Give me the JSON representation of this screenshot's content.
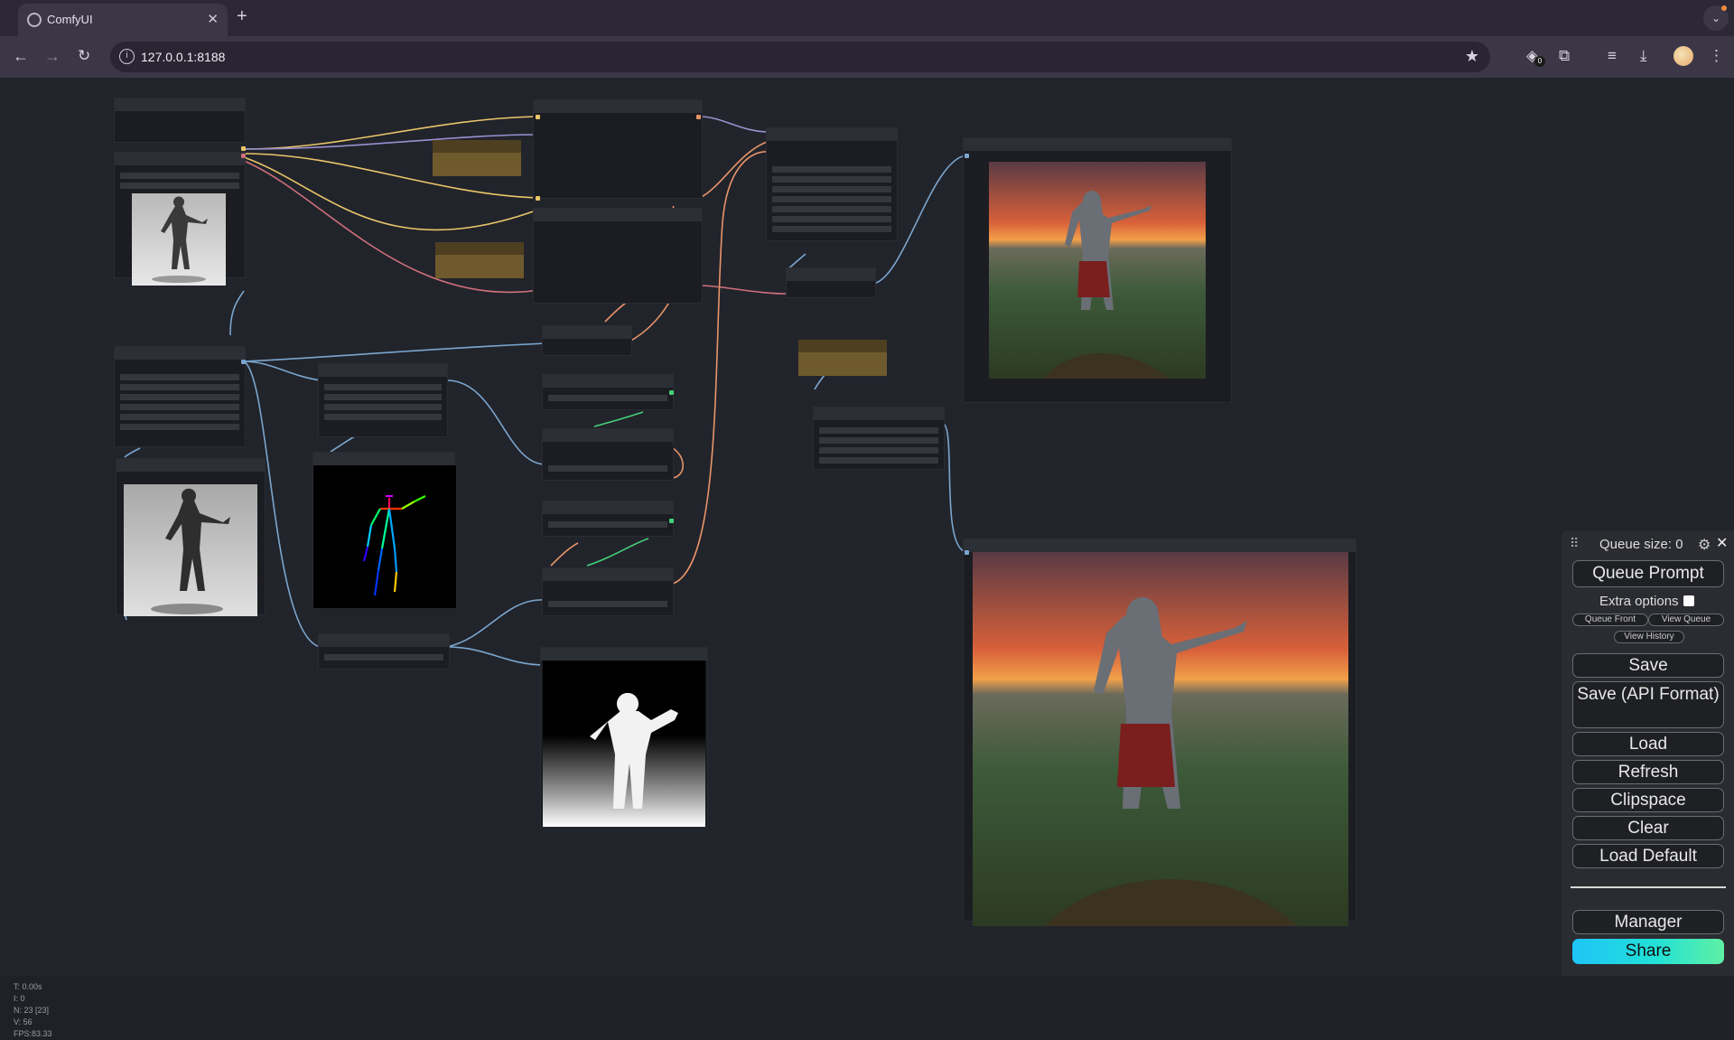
{
  "browser": {
    "tab_title": "ComfyUI",
    "tab_close": "✕",
    "new_tab": "+",
    "url": "127.0.0.1:8188",
    "extension_badge": "0"
  },
  "panel": {
    "queue_size": "Queue size: 0",
    "queue_prompt": "Queue Prompt",
    "extra_options": "Extra options",
    "extra_options_checked": false,
    "queue_front": "Queue Front",
    "view_queue": "View Queue",
    "view_history": "View History",
    "save": "Save",
    "save_api": "Save (API Format)",
    "load": "Load",
    "refresh": "Refresh",
    "clipspace": "Clipspace",
    "clear": "Clear",
    "load_default": "Load Default",
    "manager": "Manager",
    "share": "Share"
  },
  "stats": {
    "t": "T: 0.00s",
    "i": "I: 0",
    "n": "N: 23 [23]",
    "v": "V: 56",
    "fps": "FPS:83.33"
  },
  "colors": {
    "canvas_bg": "#22242b",
    "node_bg": "#1c1d22",
    "wire_yellow": "#e9c66a",
    "wire_red": "#d0707b",
    "wire_blue": "#7aa6cf",
    "wire_orange": "#e8946a",
    "wire_purple": "#9b8fd0",
    "wire_green": "#43d17a"
  }
}
